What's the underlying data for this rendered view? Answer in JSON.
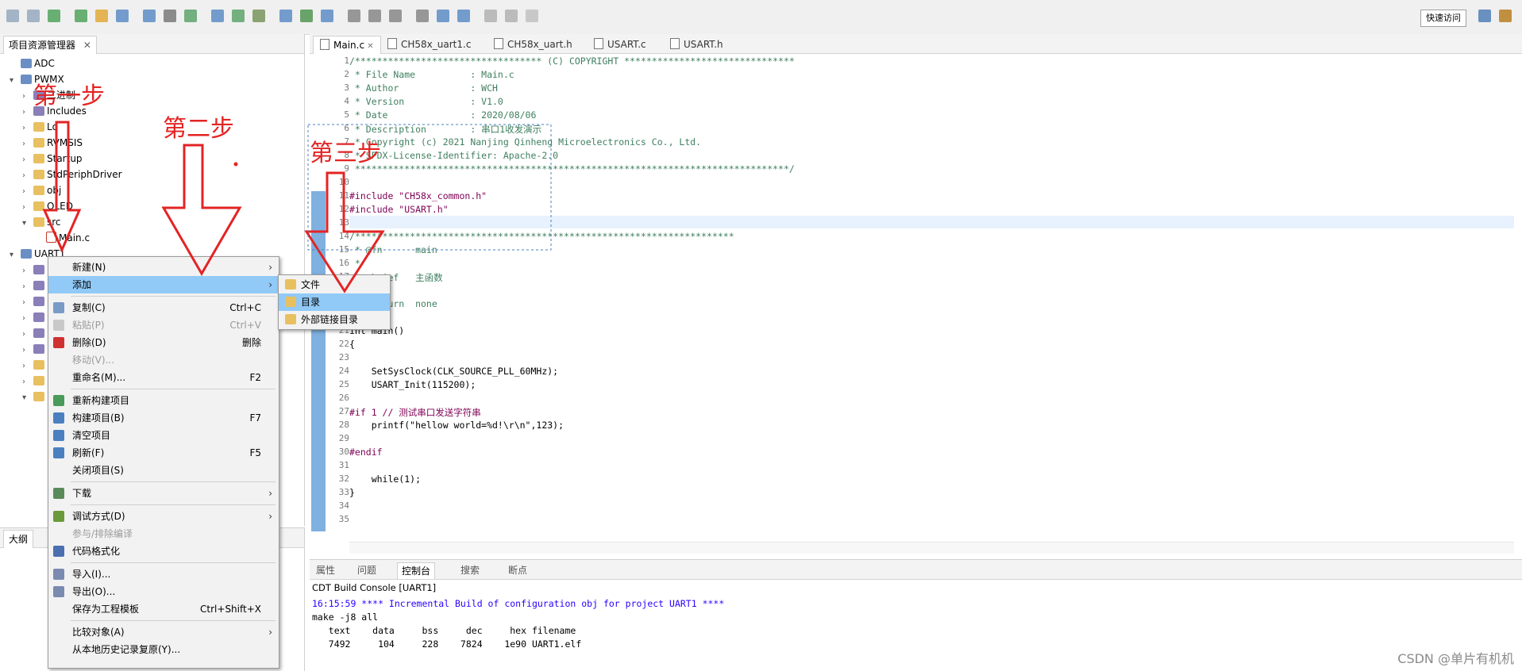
{
  "toolbar": {
    "quick_access": "快速访问"
  },
  "explorer": {
    "title": "项目资源管理器",
    "items": [
      {
        "label": "ADC",
        "indent": 0,
        "icon": "project-icon",
        "twisty": ""
      },
      {
        "label": "PWMX",
        "indent": 0,
        "icon": "project-icon",
        "twisty": "v"
      },
      {
        "label": "二进制",
        "indent": 1,
        "icon": "binary-icon",
        "twisty": ">"
      },
      {
        "label": "Includes",
        "indent": 1,
        "icon": "includes-icon",
        "twisty": ">"
      },
      {
        "label": "Ld",
        "indent": 1,
        "icon": "folder-icon",
        "twisty": ">"
      },
      {
        "label": "RVMSIS",
        "indent": 1,
        "icon": "folder-icon",
        "twisty": ">"
      },
      {
        "label": "Startup",
        "indent": 1,
        "icon": "folder-icon",
        "twisty": ">"
      },
      {
        "label": "StdPeriphDriver",
        "indent": 1,
        "icon": "folder-icon",
        "twisty": ">"
      },
      {
        "label": "obj",
        "indent": 1,
        "icon": "folder-icon",
        "twisty": ">"
      },
      {
        "label": "OLED",
        "indent": 1,
        "icon": "folder-icon",
        "twisty": ">"
      },
      {
        "label": "src",
        "indent": 1,
        "icon": "folder-icon",
        "twisty": "v"
      },
      {
        "label": "Main.c",
        "indent": 2,
        "icon": "c-file-icon",
        "twisty": ""
      },
      {
        "label": "UART1",
        "indent": 0,
        "icon": "project-icon",
        "twisty": "v"
      }
    ],
    "outline_title": "大纲"
  },
  "editor": {
    "tabs": [
      "Main.c",
      "CH58x_uart1.c",
      "CH58x_uart.h",
      "USART.c",
      "USART.h"
    ],
    "lines": [
      {
        "n": "1",
        "t": "/********************************** (C) COPYRIGHT *******************************",
        "c": "cm"
      },
      {
        "n": "2",
        "t": " * File Name          : Main.c",
        "c": "cm"
      },
      {
        "n": "3",
        "t": " * Author             : WCH",
        "c": "cm"
      },
      {
        "n": "4",
        "t": " * Version            : V1.0",
        "c": "cm"
      },
      {
        "n": "5",
        "t": " * Date               : 2020/08/06",
        "c": "cm"
      },
      {
        "n": "6",
        "t": " * Description        : 串口1收发演示",
        "c": "cm"
      },
      {
        "n": "7",
        "t": " * Copyright (c) 2021 Nanjing Qinheng Microelectronics Co., Ltd.",
        "c": "cm"
      },
      {
        "n": "8",
        "t": " * SPDX-License-Identifier: Apache-2.0",
        "c": "cm"
      },
      {
        "n": "9",
        "t": " *******************************************************************************/",
        "c": "cm"
      },
      {
        "n": "10",
        "t": "",
        "c": ""
      },
      {
        "n": "11",
        "t": "#include \"CH58x_common.h\"",
        "c": "pp"
      },
      {
        "n": "12",
        "t": "#include \"USART.h\"",
        "c": "pp"
      },
      {
        "n": "13",
        "t": "",
        "c": ""
      },
      {
        "n": "14",
        "t": "/*********************************************************************",
        "c": "cm"
      },
      {
        "n": "15",
        "t": " * @fn      main",
        "c": "cm"
      },
      {
        "n": "16",
        "t": " *",
        "c": "cm"
      },
      {
        "n": "17",
        "t": " * @brief   主函数",
        "c": "cm"
      },
      {
        "n": "18",
        "t": " *",
        "c": "cm"
      },
      {
        "n": "19",
        "t": " * @return  none",
        "c": "cm"
      },
      {
        "n": "20",
        "t": " */",
        "c": "cm"
      },
      {
        "n": "21",
        "t": "int main()",
        "c": ""
      },
      {
        "n": "22",
        "t": "{",
        "c": ""
      },
      {
        "n": "23",
        "t": "",
        "c": ""
      },
      {
        "n": "24",
        "t": "    SetSysClock(CLK_SOURCE_PLL_60MHz);",
        "c": ""
      },
      {
        "n": "25",
        "t": "    USART_Init(115200);",
        "c": ""
      },
      {
        "n": "26",
        "t": "",
        "c": ""
      },
      {
        "n": "27",
        "t": "#if 1 // 测试串口发送字符串",
        "c": "pp"
      },
      {
        "n": "28",
        "t": "    printf(\"hellow world=%d!\\r\\n\",123);",
        "c": ""
      },
      {
        "n": "29",
        "t": "",
        "c": ""
      },
      {
        "n": "30",
        "t": "#endif",
        "c": "pp"
      },
      {
        "n": "31",
        "t": "",
        "c": ""
      },
      {
        "n": "32",
        "t": "    while(1);",
        "c": ""
      },
      {
        "n": "33",
        "t": "}",
        "c": ""
      },
      {
        "n": "34",
        "t": "",
        "c": ""
      },
      {
        "n": "35",
        "t": "",
        "c": ""
      }
    ]
  },
  "console": {
    "tabs": [
      "属性",
      "问题",
      "控制台",
      "搜索",
      "断点"
    ],
    "title": "CDT Build Console [UART1]",
    "lines": [
      {
        "t": "16:15:59 **** Incremental Build of configuration obj for project UART1 ****",
        "color": "#2a00ff"
      },
      {
        "t": "make -j8 all",
        "color": "#000000"
      },
      {
        "t": "   text    data     bss     dec     hex filename",
        "color": "#000000"
      },
      {
        "t": "   7492     104     228    7824    1e90 UART1.elf",
        "color": "#000000"
      }
    ]
  },
  "context_menu": {
    "items": [
      {
        "label": "新建(N)",
        "shortcut": "",
        "submenu": true,
        "disabled": false,
        "highlight": false,
        "icon": ""
      },
      {
        "label": "添加",
        "shortcut": "",
        "submenu": true,
        "disabled": false,
        "highlight": true,
        "icon": ""
      },
      {
        "sep": true
      },
      {
        "label": "复制(C)",
        "shortcut": "Ctrl+C",
        "submenu": false,
        "disabled": false,
        "highlight": false,
        "icon": "copy-icon"
      },
      {
        "label": "粘贴(P)",
        "shortcut": "Ctrl+V",
        "submenu": false,
        "disabled": true,
        "highlight": false,
        "icon": "paste-icon"
      },
      {
        "label": "删除(D)",
        "shortcut": "删除",
        "submenu": false,
        "disabled": false,
        "highlight": false,
        "icon": "delete-icon"
      },
      {
        "label": "移动(V)...",
        "shortcut": "",
        "submenu": false,
        "disabled": true,
        "highlight": false,
        "icon": ""
      },
      {
        "label": "重命名(M)...",
        "shortcut": "F2",
        "submenu": false,
        "disabled": false,
        "highlight": false,
        "icon": ""
      },
      {
        "sep": true
      },
      {
        "label": "重新构建项目",
        "shortcut": "",
        "submenu": false,
        "disabled": false,
        "highlight": false,
        "icon": "rebuild-icon"
      },
      {
        "label": "构建项目(B)",
        "shortcut": "F7",
        "submenu": false,
        "disabled": false,
        "highlight": false,
        "icon": "build-icon"
      },
      {
        "label": "清空项目",
        "shortcut": "",
        "submenu": false,
        "disabled": false,
        "highlight": false,
        "icon": "clean-icon"
      },
      {
        "label": "刷新(F)",
        "shortcut": "F5",
        "submenu": false,
        "disabled": false,
        "highlight": false,
        "icon": "refresh-icon"
      },
      {
        "label": "关闭项目(S)",
        "shortcut": "",
        "submenu": false,
        "disabled": false,
        "highlight": false,
        "icon": ""
      },
      {
        "sep": true
      },
      {
        "label": "下载",
        "shortcut": "",
        "submenu": true,
        "disabled": false,
        "highlight": false,
        "icon": "download-icon"
      },
      {
        "sep": true
      },
      {
        "label": "调试方式(D)",
        "shortcut": "",
        "submenu": true,
        "disabled": false,
        "highlight": false,
        "icon": "debug-icon"
      },
      {
        "label": "参与/排除编译",
        "shortcut": "",
        "submenu": false,
        "disabled": true,
        "highlight": false,
        "icon": ""
      },
      {
        "label": "代码格式化",
        "shortcut": "",
        "submenu": false,
        "disabled": false,
        "highlight": false,
        "icon": "format-icon"
      },
      {
        "sep": true
      },
      {
        "label": "导入(I)...",
        "shortcut": "",
        "submenu": false,
        "disabled": false,
        "highlight": false,
        "icon": "import-icon"
      },
      {
        "label": "导出(O)...",
        "shortcut": "",
        "submenu": false,
        "disabled": false,
        "highlight": false,
        "icon": "export-icon"
      },
      {
        "label": "保存为工程模板",
        "shortcut": "Ctrl+Shift+X",
        "submenu": false,
        "disabled": false,
        "highlight": false,
        "icon": ""
      },
      {
        "sep": true
      },
      {
        "label": "比较对象(A)",
        "shortcut": "",
        "submenu": true,
        "disabled": false,
        "highlight": false,
        "icon": ""
      },
      {
        "label": "从本地历史记录复原(Y)...",
        "shortcut": "",
        "submenu": false,
        "disabled": false,
        "highlight": false,
        "icon": ""
      }
    ]
  },
  "sub_menu": {
    "items": [
      {
        "label": "文件",
        "highlight": false
      },
      {
        "label": "目录",
        "highlight": true
      },
      {
        "label": "外部链接目录",
        "highlight": false
      }
    ]
  },
  "annotations": {
    "step1": "第一步",
    "step2": "第二步",
    "step3": "第三步",
    "color": "#e32424"
  },
  "watermark": "CSDN @单片有机机"
}
